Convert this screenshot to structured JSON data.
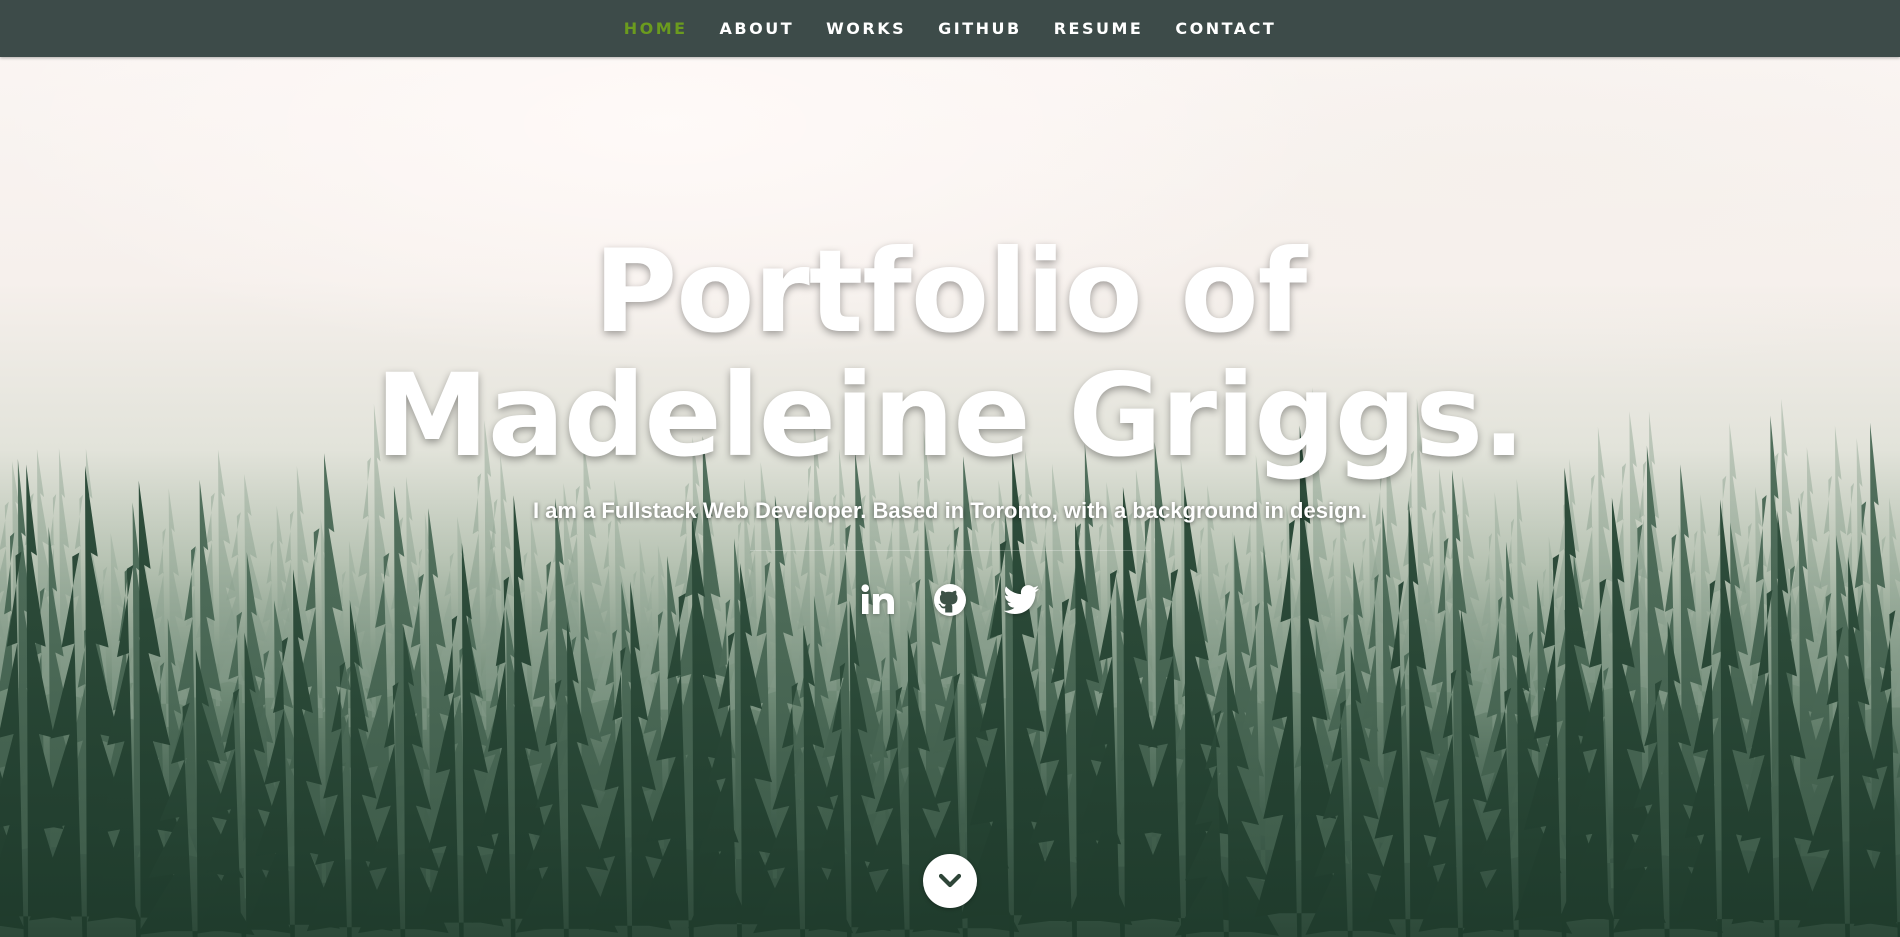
{
  "nav": {
    "items": [
      {
        "label": "HOME",
        "active": true
      },
      {
        "label": "ABOUT",
        "active": false
      },
      {
        "label": "WORKS",
        "active": false
      },
      {
        "label": "GITHUB",
        "active": false
      },
      {
        "label": "RESUME",
        "active": false
      },
      {
        "label": "CONTACT",
        "active": false
      }
    ],
    "active_color": "#6b9b1e",
    "background": "#3d4b49"
  },
  "hero": {
    "title": "Portfolio of Madeleine Griggs.",
    "subtitle": "I am a Fullstack Web Developer. Based in Toronto, with a background in design."
  },
  "social": [
    {
      "icon": "linkedin-icon"
    },
    {
      "icon": "github-icon"
    },
    {
      "icon": "twitter-icon"
    }
  ],
  "scroll_button": {
    "icon": "chevron-down-icon"
  }
}
